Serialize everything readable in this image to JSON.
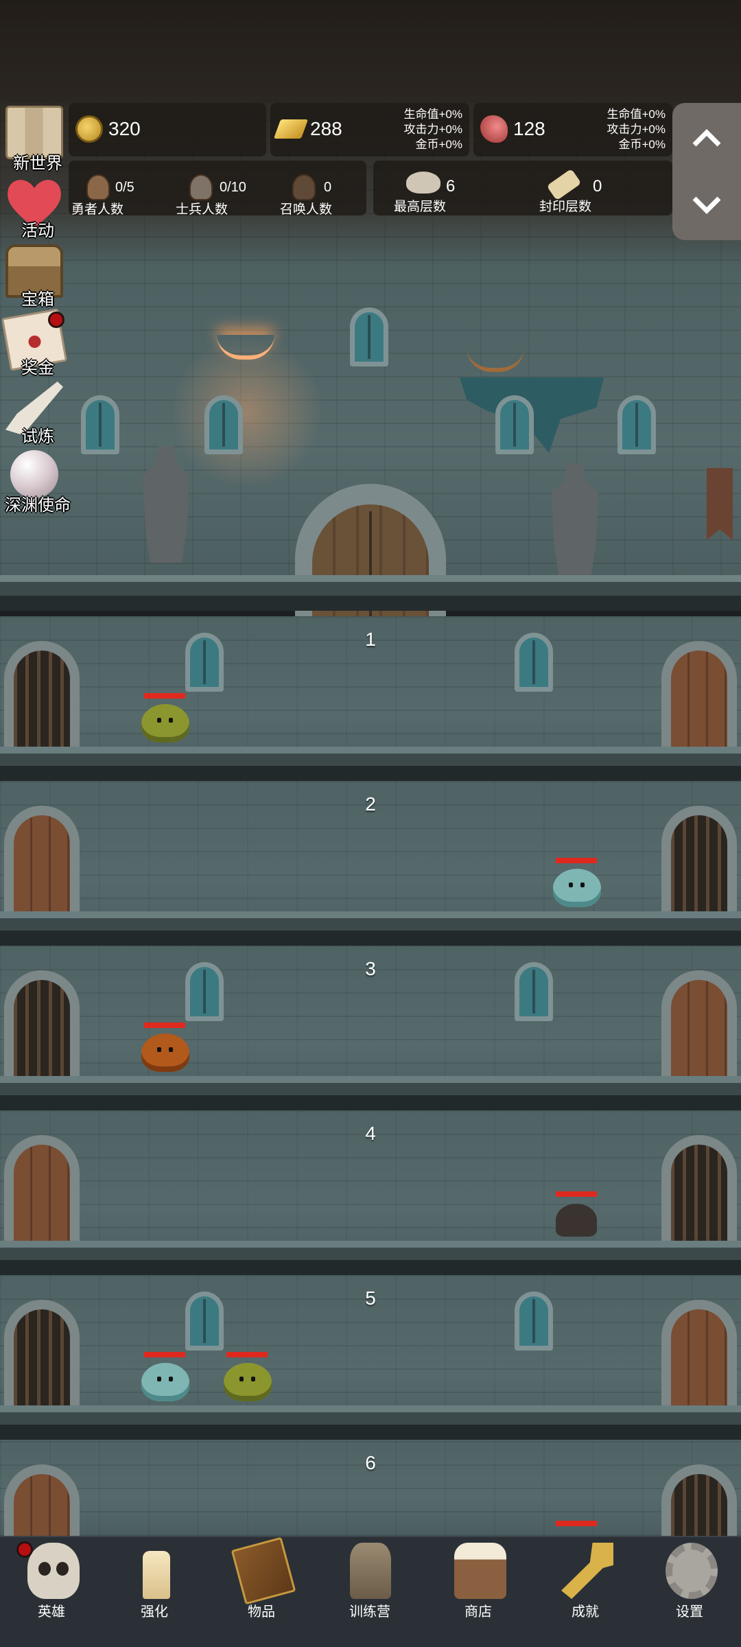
{
  "resources": {
    "coins": "320",
    "gold": "288",
    "gold_bonus": [
      "生命值+0%",
      "攻击力+0%",
      "金币+0%"
    ],
    "meat": "128",
    "meat_bonus": [
      "生命值+0%",
      "攻击力+0%",
      "金币+0%"
    ]
  },
  "stats": {
    "heroes": {
      "value": "0/5",
      "label": "勇者人数"
    },
    "soldiers": {
      "value": "0/10",
      "label": "士兵人数"
    },
    "summons": {
      "value": "0",
      "label": "召唤人数"
    },
    "max_floor": {
      "value": "6",
      "label": "最高层数"
    },
    "sealed_floor": {
      "value": "0",
      "label": "封印层数"
    }
  },
  "side_menu": [
    {
      "label": "新世界",
      "icon": "map-icon",
      "badge": false
    },
    {
      "label": "活动",
      "icon": "heart-icon",
      "badge": false
    },
    {
      "label": "宝箱",
      "icon": "chest-icon",
      "badge": false
    },
    {
      "label": "奖金",
      "icon": "letter-icon",
      "badge": true
    },
    {
      "label": "试炼",
      "icon": "feather-icon",
      "badge": false
    },
    {
      "label": "深渊使命",
      "icon": "pearl-icon",
      "badge": false
    }
  ],
  "floors": [
    {
      "number": "1",
      "enemies": [
        "green-slime"
      ]
    },
    {
      "number": "2",
      "enemies": [
        "teal-slime"
      ]
    },
    {
      "number": "3",
      "enemies": [
        "orange-slime"
      ]
    },
    {
      "number": "4",
      "enemies": [
        "spider"
      ]
    },
    {
      "number": "5",
      "enemies": [
        "teal-slime",
        "green-slime"
      ]
    },
    {
      "number": "6",
      "enemies": [
        "unknown"
      ]
    }
  ],
  "bottom_nav": [
    {
      "label": "英雄",
      "icon": "skull-icon",
      "badge": true
    },
    {
      "label": "强化",
      "icon": "candle-icon",
      "badge": false
    },
    {
      "label": "物品",
      "icon": "book-icon",
      "badge": false
    },
    {
      "label": "训练营",
      "icon": "lantern-icon",
      "badge": false
    },
    {
      "label": "商店",
      "icon": "mug-icon",
      "badge": false
    },
    {
      "label": "成就",
      "icon": "key-icon",
      "badge": false
    },
    {
      "label": "设置",
      "icon": "gear-icon",
      "badge": false
    }
  ],
  "colors": {
    "hp_bar": "#e0291e",
    "badge": "#b50f12",
    "wall": "#566a6c",
    "nav_bg": "#2a3036"
  }
}
